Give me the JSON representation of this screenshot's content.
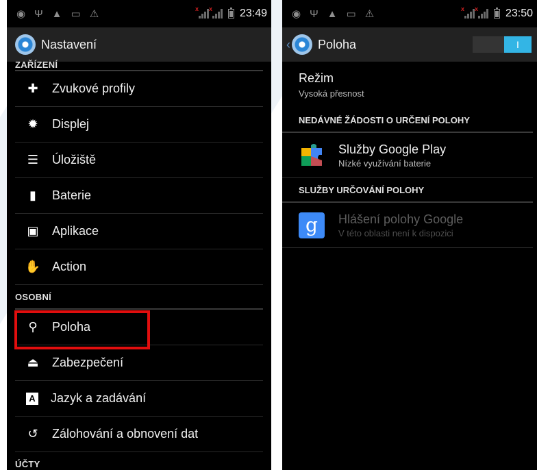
{
  "left": {
    "status": {
      "time": "23:49"
    },
    "title": "Nastavení",
    "sections": [
      {
        "header": "ZAŘÍZENÍ",
        "items": [
          {
            "icon": "sound-profiles-icon",
            "label": "Zvukové profily"
          },
          {
            "icon": "display-icon",
            "label": "Displej"
          },
          {
            "icon": "storage-icon",
            "label": "Úložiště"
          },
          {
            "icon": "battery-icon",
            "label": "Baterie"
          },
          {
            "icon": "apps-icon",
            "label": "Aplikace"
          },
          {
            "icon": "hand-icon",
            "label": "Action"
          }
        ]
      },
      {
        "header": "OSOBNÍ",
        "items": [
          {
            "icon": "location-pin-icon",
            "label": "Poloha"
          },
          {
            "icon": "lock-icon",
            "label": "Zabezpečení"
          },
          {
            "icon": "keyboard-a-icon",
            "label": "Jazyk a zadávání"
          },
          {
            "icon": "backup-icon",
            "label": "Zálohování a obnovení dat"
          }
        ]
      },
      {
        "header": "ÚČTY",
        "items": []
      }
    ]
  },
  "right": {
    "status": {
      "time": "23:50"
    },
    "title": "Poloha",
    "toggle_text": "I",
    "mode": {
      "title": "Režim",
      "value": "Vysoká přesnost"
    },
    "recent_header": "NEDÁVNÉ ŽÁDOSTI O URČENÍ POLOHY",
    "recent_item": {
      "icon": "google-play-services-icon",
      "title": "Služby Google Play",
      "subtitle": "Nízké využívání baterie"
    },
    "services_header": "SLUŽBY URČOVÁNÍ POLOHY",
    "services_item": {
      "icon": "google-g-icon",
      "icon_glyph": "g",
      "title": "Hlášení polohy Google",
      "subtitle": "V této oblasti není k dispozici"
    }
  },
  "colors": {
    "accent": "#33b5e5",
    "highlight": "#e10e0e",
    "background": "#000000"
  }
}
